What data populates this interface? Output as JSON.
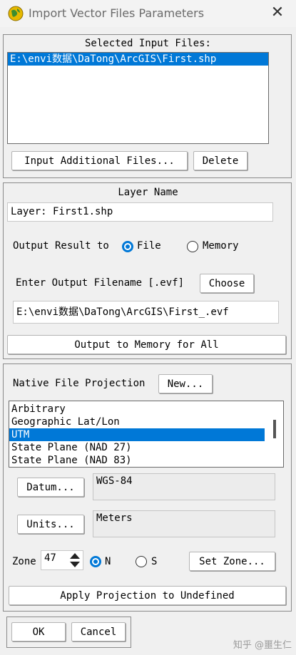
{
  "window": {
    "title": "Import Vector Files Parameters",
    "close_glyph": "✕"
  },
  "input_files": {
    "heading": "Selected Input Files:",
    "files": [
      "E:\\envi数据\\DaTong\\ArcGIS\\First.shp"
    ],
    "add_button": "Input Additional Files...",
    "delete_button": "Delete"
  },
  "layer": {
    "heading": "Layer Name",
    "name_value": "Layer: First1.shp",
    "output_result_label": "Output Result to",
    "file_option": "File",
    "memory_option": "Memory",
    "selected_output": "File",
    "filename_label": "Enter Output Filename [.evf]",
    "choose_button": "Choose",
    "filename_value": "E:\\envi数据\\DaTong\\ArcGIS\\First_.evf",
    "memory_all_button": "Output to Memory for All"
  },
  "projection": {
    "label": "Native File Projection",
    "new_button": "New...",
    "options": [
      "Arbitrary",
      "Geographic Lat/Lon",
      "UTM",
      "State Plane (NAD 27)",
      "State Plane (NAD 83)"
    ],
    "selected": "UTM",
    "datum_button": "Datum...",
    "datum_value": "WGS-84",
    "units_button": "Units...",
    "units_value": "Meters",
    "zone_label": "Zone",
    "zone_value": "47",
    "north_option": "N",
    "south_option": "S",
    "hemisphere": "N",
    "set_zone_button": "Set Zone...",
    "apply_button": "Apply Projection to Undefined"
  },
  "footer": {
    "ok_button": "OK",
    "cancel_button": "Cancel"
  },
  "watermark": "知乎 @噩生仁",
  "colors": {
    "selection": "#0078d7",
    "background": "#f0f0f0"
  }
}
